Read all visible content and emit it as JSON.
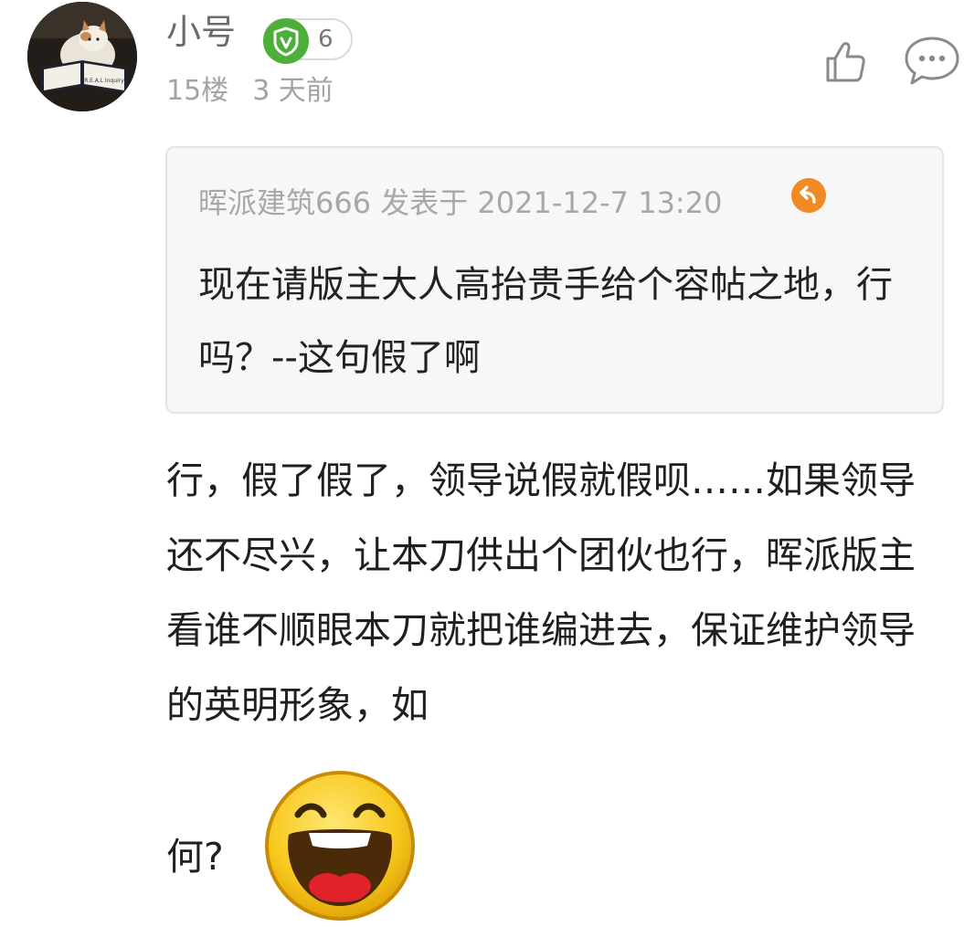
{
  "user": {
    "name": "小号",
    "level": "6",
    "avatar_text": "R.E.A.L Inquiry"
  },
  "post_meta": {
    "floor": "15楼",
    "time": "3 天前"
  },
  "quote": {
    "meta": "晖派建筑666 发表于 2021-12-7 13:20",
    "text": "现在请版主大人高抬贵手给个容帖之地，行吗？--这句假了啊"
  },
  "reply": {
    "text": "行，假了假了，领导说假就假呗……如果领导还不尽兴，让本刀供出个团伙也行，晖派版主看谁不顺眼本刀就把谁编进去，保证维护领导的英明形象，如",
    "tail": "何?"
  },
  "icons": {
    "like": "thumbs-up-icon",
    "comment": "comment-bubble-icon",
    "badge": "shield-v-icon",
    "jump": "jump-arrow-icon",
    "emoji": "laughing-face-emoji"
  },
  "colors": {
    "badge_green": "#4caf3a",
    "jump_orange": "#f08a24",
    "emoji_yellow": "#f7c81e"
  }
}
